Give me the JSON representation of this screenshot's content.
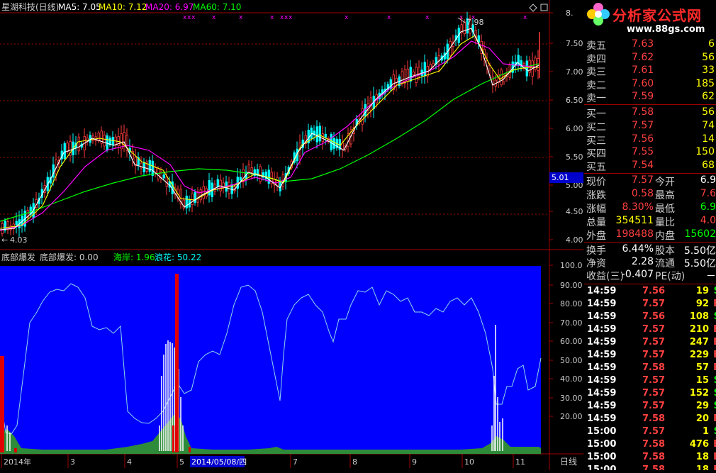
{
  "header": {
    "stock": "星湖科技(日线)",
    "ma5": "MA5: 7.05",
    "ma10": "MA10: 7.12",
    "ma20": "MA20: 6.97",
    "ma60": "MA60: 7.10"
  },
  "price_axis": [
    "8.",
    "7.50",
    "7.00",
    "6.50",
    "6.00",
    "5.50",
    "5.00",
    "4.50",
    "4.00"
  ],
  "current_price_tag": "5.01",
  "high_marker": "7.98",
  "low_marker": "4.03",
  "indicator": {
    "title": "底部爆发",
    "label": "底部爆发: 0.00",
    "haian": "海岸: 1.96",
    "langhua": "浪花: 50.22",
    "axis": [
      "100.0",
      "90.00",
      "80.00",
      "70.00",
      "60.00",
      "50.00",
      "40.00",
      "30.00",
      "20.00"
    ]
  },
  "date_axis": {
    "labels": [
      "2014年",
      "3",
      "4",
      "5",
      "7",
      "8",
      "9",
      "10",
      "11"
    ],
    "cursor_date": "2014/05/08/四",
    "period": "日线"
  },
  "logo": {
    "title": "分析家公式网",
    "url": "www.88gs.com"
  },
  "quote": {
    "asks": [
      {
        "label": "卖五",
        "price": "7.63",
        "vol": "6"
      },
      {
        "label": "卖四",
        "price": "7.62",
        "vol": "56"
      },
      {
        "label": "卖三",
        "price": "7.61",
        "vol": "33"
      },
      {
        "label": "卖二",
        "price": "7.60",
        "vol": "185"
      },
      {
        "label": "卖一",
        "price": "7.59",
        "vol": "62"
      }
    ],
    "bids": [
      {
        "label": "买一",
        "price": "7.58",
        "vol": "56"
      },
      {
        "label": "买二",
        "price": "7.57",
        "vol": "74"
      },
      {
        "label": "买三",
        "price": "7.56",
        "vol": "14"
      },
      {
        "label": "买四",
        "price": "7.55",
        "vol": "150"
      },
      {
        "label": "买五",
        "price": "7.54",
        "vol": "68"
      }
    ],
    "stats": [
      {
        "l1": "现价",
        "v1": "7.57",
        "l2": "今开",
        "v2": "6.9"
      },
      {
        "l1": "涨跌",
        "v1": "0.58",
        "l2": "最高",
        "v2": "7.6"
      },
      {
        "l1": "涨幅",
        "v1": "8.30%",
        "l2": "最低",
        "v2": "6.9"
      },
      {
        "l1": "总量",
        "v1": "354511",
        "l2": "量比",
        "v2": "4.0"
      },
      {
        "l1": "外盘",
        "v1": "198488",
        "l2": "内盘",
        "v2": "15602"
      }
    ],
    "fund": [
      {
        "l1": "换手",
        "v1": "6.44%",
        "l2": "股本",
        "v2": "5.50亿"
      },
      {
        "l1": "净资",
        "v1": "2.28",
        "l2": "流通",
        "v2": "5.50亿"
      },
      {
        "l1": "收益(三)",
        "v1": "-0.407",
        "l2": "PE(动)",
        "v2": "－"
      }
    ],
    "ticks": [
      {
        "t": "14:59",
        "p": "7.56",
        "v": "19",
        "s": "S"
      },
      {
        "t": "14:59",
        "p": "7.57",
        "v": "92",
        "s": "B"
      },
      {
        "t": "14:59",
        "p": "7.56",
        "v": "108",
        "s": "S"
      },
      {
        "t": "14:59",
        "p": "7.57",
        "v": "210",
        "s": "B"
      },
      {
        "t": "14:59",
        "p": "7.57",
        "v": "247",
        "s": "B"
      },
      {
        "t": "14:59",
        "p": "7.57",
        "v": "229",
        "s": "B"
      },
      {
        "t": "14:59",
        "p": "7.58",
        "v": "57",
        "s": "B"
      },
      {
        "t": "14:59",
        "p": "7.57",
        "v": "15",
        "s": "S"
      },
      {
        "t": "14:59",
        "p": "7.57",
        "v": "152",
        "s": "S"
      },
      {
        "t": "14:59",
        "p": "7.57",
        "v": "29",
        "s": "S"
      },
      {
        "t": "14:59",
        "p": "7.58",
        "v": "20",
        "s": "B"
      },
      {
        "t": "15:00",
        "p": "7.57",
        "v": "1",
        "s": "S"
      },
      {
        "t": "15:00",
        "p": "7.58",
        "v": "476",
        "s": "B"
      },
      {
        "t": "15:00",
        "p": "7.58",
        "v": "18",
        "s": "B"
      },
      {
        "t": "15:00",
        "p": "7.58",
        "v": "18",
        "s": "B"
      }
    ]
  },
  "colors": {
    "up": "#ff3c3c",
    "down": "#00ffff",
    "ma5": "#ffffff",
    "ma10": "#ffff00",
    "ma20": "#ff00ff",
    "ma60": "#00ff00",
    "indicator_bg": "#0000ff",
    "grid": "#a00000"
  }
}
